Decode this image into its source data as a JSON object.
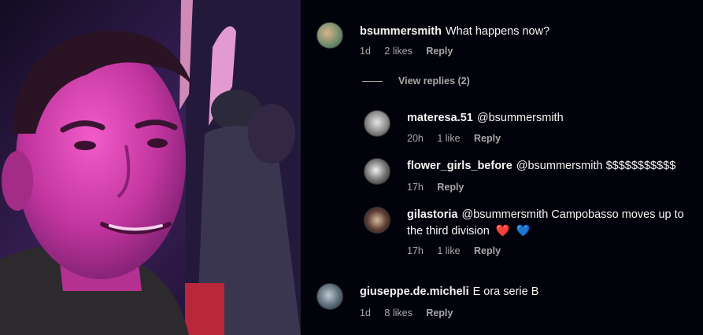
{
  "comments": [
    {
      "username": "bsummersmith",
      "text": "What happens now?",
      "age": "1d",
      "likes": "2 likes",
      "reply": "Reply"
    }
  ],
  "view_replies": "View replies (2)",
  "replies": [
    {
      "username": "materesa.51",
      "text": "@bsummersmith",
      "age": "20h",
      "likes": "1 like",
      "reply": "Reply"
    },
    {
      "username": "flower_girls_before",
      "text": "@bsummersmith $$$$$$$$$$$",
      "age": "17h",
      "reply": "Reply"
    },
    {
      "username": "gilastoria",
      "text_line1": "@bsummersmith Campobasso moves up to",
      "text_line2": "the third division",
      "emoji_red_heart": "❤️",
      "emoji_blue_heart": "💙",
      "age": "17h",
      "likes": "1 like",
      "reply": "Reply"
    }
  ],
  "comment2": {
    "username": "giuseppe.de.micheli",
    "text": "E ora serie B",
    "age": "1d",
    "likes": "8 likes",
    "reply": "Reply"
  },
  "colors": {
    "background": "#02030a",
    "secondary_text": "#a8a8a8",
    "primary_text": "#f5f5f5",
    "heart_red": "#e0243b",
    "heart_blue": "#2f7de1"
  }
}
